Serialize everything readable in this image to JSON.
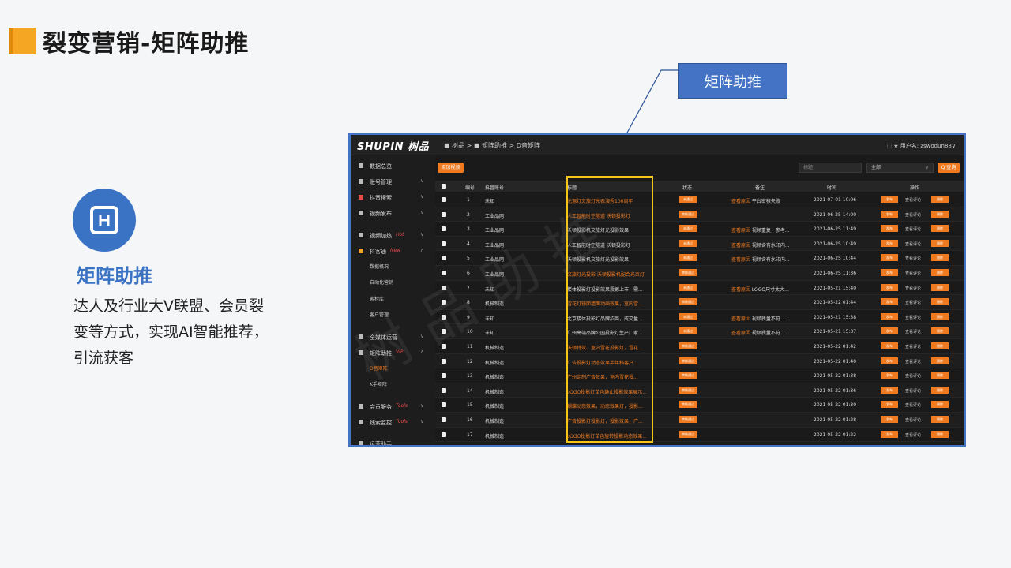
{
  "slide": {
    "title": "裂变营销-矩阵助推"
  },
  "feature": {
    "title": "矩阵助推",
    "desc_lines": [
      "达人及行业大V联盟、会员裂",
      "变等方式，实现AI智能推荐，",
      "引流获客"
    ]
  },
  "callout": {
    "label": "矩阵助推"
  },
  "app": {
    "brand": "SHUPIN 树品",
    "breadcrumb": "■ 树品  >   ■ 矩阵助推  >   D音矩阵",
    "user": "⬚ ★ 用户名: zswodun88∨",
    "sidebar": [
      {
        "label": "数据总览",
        "tag": "",
        "chev": ""
      },
      {
        "label": "账号管理",
        "tag": "",
        "chev": "∨"
      },
      {
        "label": "抖音搜索",
        "tag": "",
        "chev": "∨"
      },
      {
        "label": "视频发布",
        "tag": "",
        "chev": "∨"
      },
      {
        "label": "视频加热",
        "tag": "Hot",
        "chev": "∨"
      },
      {
        "label": "抖客通",
        "tag": "New",
        "chev": "∧"
      },
      {
        "label": "全媒体运营",
        "tag": "",
        "chev": "∨"
      },
      {
        "label": "矩阵助推",
        "tag": "VIP",
        "chev": "∧"
      },
      {
        "label": "会员服务",
        "tag": "Tools",
        "chev": "∨"
      },
      {
        "label": "线索监控",
        "tag": "Tools",
        "chev": "∨"
      },
      {
        "label": "运营助手",
        "tag": "",
        "chev": ""
      }
    ],
    "sub_items_a": [
      "数据概况",
      "自动化营销",
      "素材库",
      "客户管理"
    ],
    "sub_items_b": [
      "D音矩阵",
      "K手矩阵"
    ],
    "add_button": "添加视频",
    "filter_placeholder": "标题",
    "filter_select": "全部",
    "search_button": "Q 查询",
    "columns": [
      "编号",
      "抖音账号",
      "标题",
      "状态",
      "备注",
      "时间",
      "操作"
    ],
    "rows": [
      {
        "no": "1",
        "account": "未知",
        "title": "光源灯文旅灯光表演秀100周年",
        "title_orange": true,
        "status": "未通过",
        "note": "查看原因 平台审核失败",
        "time": "2021-07-01 10:06",
        "actions": [
          "发布",
          "查看评论",
          "删除"
        ]
      },
      {
        "no": "2",
        "account": "工业品网",
        "title": "人工智能时空隧道 沃顿投影灯",
        "title_orange": true,
        "status": "审核通过",
        "note": "",
        "time": "2021-06-25 14:00",
        "actions": [
          "发布",
          "查看评论",
          "删除"
        ]
      },
      {
        "no": "3",
        "account": "工业品网",
        "title": "沃顿投影机文旅灯光投影效果",
        "title_orange": false,
        "status": "未通过",
        "note": "查看原因 视频重复，参考...",
        "time": "2021-06-25 11:49",
        "actions": [
          "发布",
          "查看评论",
          "删除"
        ]
      },
      {
        "no": "4",
        "account": "工业品网",
        "title": "人工智能时空隧道 沃顿投影灯",
        "title_orange": false,
        "status": "未通过",
        "note": "查看原因 视频含有水印内...",
        "time": "2021-06-25 10:49",
        "actions": [
          "发布",
          "查看评论",
          "删除"
        ]
      },
      {
        "no": "5",
        "account": "工业品网",
        "title": "沃顿投影机文旅灯光投影效果",
        "title_orange": false,
        "status": "未通过",
        "note": "查看原因 视频含有水印内...",
        "time": "2021-06-25 10:44",
        "actions": [
          "发布",
          "查看评论",
          "删除"
        ]
      },
      {
        "no": "6",
        "account": "工业品网",
        "title": "文旅灯光投影 沃顿投影机配合光束灯",
        "title_orange": true,
        "status": "审核通过",
        "note": "",
        "time": "2021-06-25 11:36",
        "actions": [
          "发布",
          "查看评论",
          "删除"
        ]
      },
      {
        "no": "7",
        "account": "未知",
        "title": "楼体投影灯投影效果震撼上市，需...",
        "title_orange": false,
        "status": "未通过",
        "note": "查看原因 LOGO尺寸太大...",
        "time": "2021-05-21 15:40",
        "actions": [
          "发布",
          "查看评论",
          "删除"
        ]
      },
      {
        "no": "8",
        "account": "机械制造",
        "title": "雪花灯镜面墙面动画效果，室内雪...",
        "title_orange": true,
        "status": "审核通过",
        "note": "",
        "time": "2021-05-22 01:44",
        "actions": [
          "发布",
          "查看评论",
          "删除"
        ]
      },
      {
        "no": "9",
        "account": "未知",
        "title": "北京楼体投影灯品牌招商，成交量...",
        "title_orange": false,
        "status": "未通过",
        "note": "查看原因 视频质量不符...",
        "time": "2021-05-21 15:38",
        "actions": [
          "发布",
          "查看评论",
          "删除"
        ]
      },
      {
        "no": "10",
        "account": "未知",
        "title": "广州高端品牌公园投影灯生产厂家...",
        "title_orange": false,
        "status": "未通过",
        "note": "查看原因 视频质量不符...",
        "time": "2021-05-21 15:37",
        "actions": [
          "发布",
          "查看评论",
          "删除"
        ]
      },
      {
        "no": "11",
        "account": "机械制造",
        "title": "沃顿特效、室内雪花投影灯，雪花...",
        "title_orange": true,
        "status": "审核通过",
        "note": "",
        "time": "2021-05-22 01:42",
        "actions": [
          "发布",
          "查看评论",
          "删除"
        ]
      },
      {
        "no": "12",
        "account": "机械制造",
        "title": "广告投影灯动态效果半年档客户...",
        "title_orange": true,
        "status": "审核通过",
        "note": "",
        "time": "2021-05-22 01:40",
        "actions": [
          "发布",
          "查看评论",
          "删除"
        ]
      },
      {
        "no": "13",
        "account": "机械制造",
        "title": "广州定制广告效果，室内雪花投...",
        "title_orange": true,
        "status": "审核通过",
        "note": "",
        "time": "2021-05-22 01:38",
        "actions": [
          "发布",
          "查看评论",
          "删除"
        ]
      },
      {
        "no": "14",
        "account": "机械制造",
        "title": "LOGO投影灯单色静止投影效果展示...",
        "title_orange": true,
        "status": "审核通过",
        "note": "",
        "time": "2021-05-22 01:36",
        "actions": [
          "发布",
          "查看评论",
          "删除"
        ]
      },
      {
        "no": "15",
        "account": "机械制造",
        "title": "蝴蝶动态效果，动态效果灯，投影...",
        "title_orange": true,
        "status": "审核通过",
        "note": "",
        "time": "2021-05-22 01:30",
        "actions": [
          "发布",
          "查看评论",
          "删除"
        ]
      },
      {
        "no": "16",
        "account": "机械制造",
        "title": "广告投影灯投影灯，投影效果，广...",
        "title_orange": true,
        "status": "审核通过",
        "note": "",
        "time": "2021-05-22 01:28",
        "actions": [
          "发布",
          "查看评论",
          "删除"
        ]
      },
      {
        "no": "17",
        "account": "机械制造",
        "title": "LOGO投影灯单色旋转投影动态效果...",
        "title_orange": true,
        "status": "审核通过",
        "note": "",
        "time": "2021-05-22 01:22",
        "actions": [
          "发布",
          "查看评论",
          "删除"
        ]
      }
    ]
  },
  "colors": {
    "accent": "#f07a1f",
    "blue": "#4472c4",
    "highlight": "#f5c518"
  }
}
